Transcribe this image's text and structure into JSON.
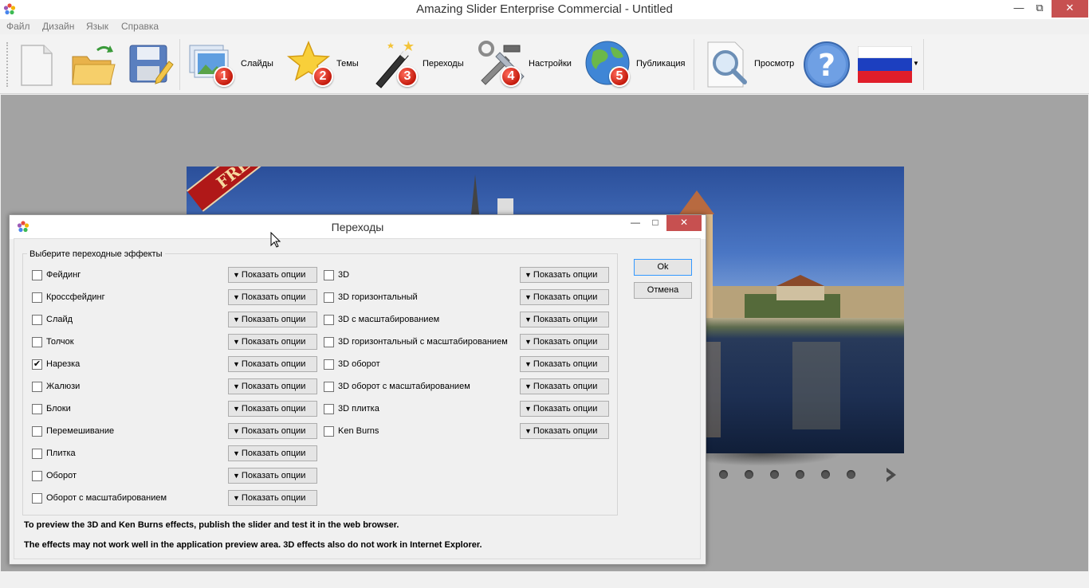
{
  "window": {
    "title": "Amazing Slider Enterprise Commercial - Untitled",
    "controls": {
      "minimize": "—",
      "restore": "⧉",
      "close": "✕"
    }
  },
  "menu": [
    "Файл",
    "Дизайн",
    "Язык",
    "Справка"
  ],
  "toolbar": {
    "new_icon": "new-file-icon",
    "open_icon": "open-folder-icon",
    "save_icon": "save-icon",
    "steps": [
      {
        "label": "Слайды",
        "number": "1",
        "icon": "slides-icon"
      },
      {
        "label": "Темы",
        "number": "2",
        "icon": "star-icon"
      },
      {
        "label": "Переходы",
        "number": "3",
        "icon": "magic-wand-icon"
      },
      {
        "label": "Настройки",
        "number": "4",
        "icon": "tools-icon"
      },
      {
        "label": "Публикация",
        "number": "5",
        "icon": "globe-icon"
      }
    ],
    "preview_label": "Просмотр",
    "help_icon": "help-icon",
    "language_flag": "russian-flag-icon"
  },
  "slider_preview": {
    "ribbon_text": "FREE",
    "dots": 6
  },
  "dialog": {
    "title": "Переходы",
    "controls": {
      "minimize": "—",
      "maximize": "□",
      "close": "✕"
    },
    "group_label": "Выберите переходные эффекты",
    "show_options_label": "Показать опции",
    "left_effects": [
      {
        "label": "Фейдинг",
        "checked": false
      },
      {
        "label": "Кроссфейдинг",
        "checked": false
      },
      {
        "label": "Слайд",
        "checked": false
      },
      {
        "label": "Толчок",
        "checked": false
      },
      {
        "label": "Нарезка",
        "checked": true
      },
      {
        "label": "Жалюзи",
        "checked": false
      },
      {
        "label": "Блоки",
        "checked": false
      },
      {
        "label": "Перемешивание",
        "checked": false
      },
      {
        "label": "Плитка",
        "checked": false
      },
      {
        "label": "Оборот",
        "checked": false
      },
      {
        "label": "Оборот с масштабированием",
        "checked": false
      }
    ],
    "right_effects": [
      {
        "label": "3D",
        "checked": false
      },
      {
        "label": "3D горизонтальный",
        "checked": false
      },
      {
        "label": "3D с масштабированием",
        "checked": false
      },
      {
        "label": "3D горизонтальный с масштабированием",
        "checked": false
      },
      {
        "label": "3D оборот",
        "checked": false
      },
      {
        "label": "3D оборот с масштабированием",
        "checked": false
      },
      {
        "label": "3D плитка",
        "checked": false
      },
      {
        "label": "Ken Burns",
        "checked": false
      }
    ],
    "ok_label": "Ok",
    "cancel_label": "Отмена",
    "note1": "To preview the 3D and Ken Burns effects, publish the slider and test it in the web browser.",
    "note2": "The effects may not work well in the application preview area. 3D effects also do not work in Internet Explorer."
  }
}
